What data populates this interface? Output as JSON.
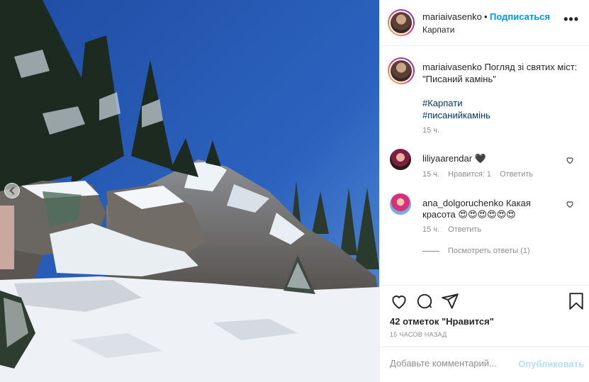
{
  "post": {
    "username": "mariaivasenko",
    "separator": "•",
    "follow_label": "Подписаться",
    "location": "Карпати",
    "more_label": "•••"
  },
  "caption": {
    "username": "mariaivasenko",
    "text": "Погляд зі святих міст: \"Писаний камінь\"",
    "tags": [
      "#Карпати",
      "#писанийкамінь"
    ],
    "time": "15 ч."
  },
  "comments": [
    {
      "username": "liliyaarendar",
      "text": "🖤",
      "time": "15 ч.",
      "likes": "Нравится: 1",
      "reply": "Ответить"
    },
    {
      "username": "ana_dolgoruchenko",
      "text": "Какая красота 😍😍😍😍😍😍",
      "time": "15 ч.",
      "reply": "Ответить"
    }
  ],
  "view_replies": "Посмотреть ответы (1)",
  "likes_count": "42 отметок \"Нравится\"",
  "posted_ago": "15 ЧАСОВ НАЗАД",
  "comment_input": {
    "placeholder": "Добавьте комментарий...",
    "value": ""
  },
  "publish_label": "Опубликовать",
  "icons": [
    "heart-icon",
    "comment-icon",
    "share-icon",
    "bookmark-icon",
    "more-icon",
    "carousel-prev-icon"
  ],
  "colors": {
    "accent": "#0095f6",
    "link": "#00376b",
    "muted": "#8e8e8e",
    "publish_disabled": "#b2dffc"
  }
}
